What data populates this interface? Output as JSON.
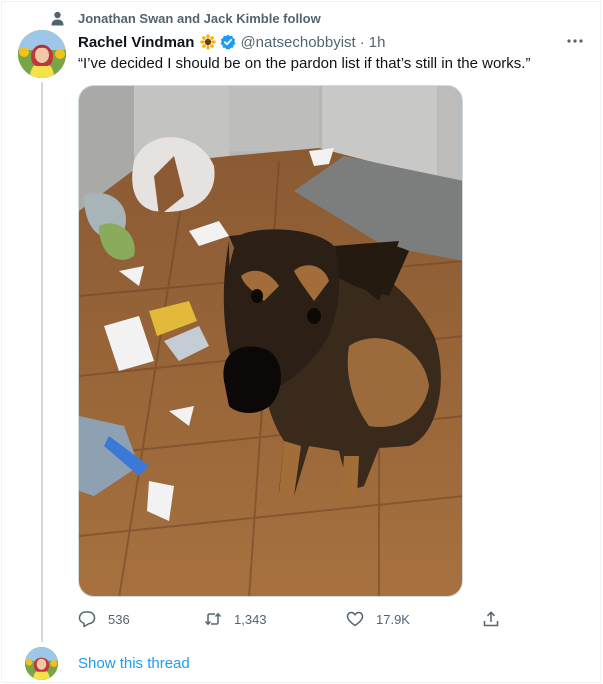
{
  "social_context": {
    "text": "Jonathan Swan and Jack Kimble follow"
  },
  "tweet": {
    "display_name": "Rachel Vindman",
    "handle": "@natsechobbyist",
    "separator": "·",
    "time": "1h",
    "text": "“I’ve decided I should be on the pardon list if that’s still in the works.”"
  },
  "actions": {
    "replies": "536",
    "retweets": "1,343",
    "likes": "17.9K"
  },
  "show_thread": "Show this thread",
  "icons": {
    "social": "person-icon",
    "verified": "verified-badge-icon",
    "emoji": "sunflower-emoji",
    "more": "more-icon",
    "reply": "reply-icon",
    "retweet": "retweet-icon",
    "like": "heart-icon",
    "share": "share-icon"
  },
  "colors": {
    "link": "#1d9bf0",
    "secondary_text": "#536471",
    "text": "#0f1419",
    "verified": "#1d9bf0"
  }
}
